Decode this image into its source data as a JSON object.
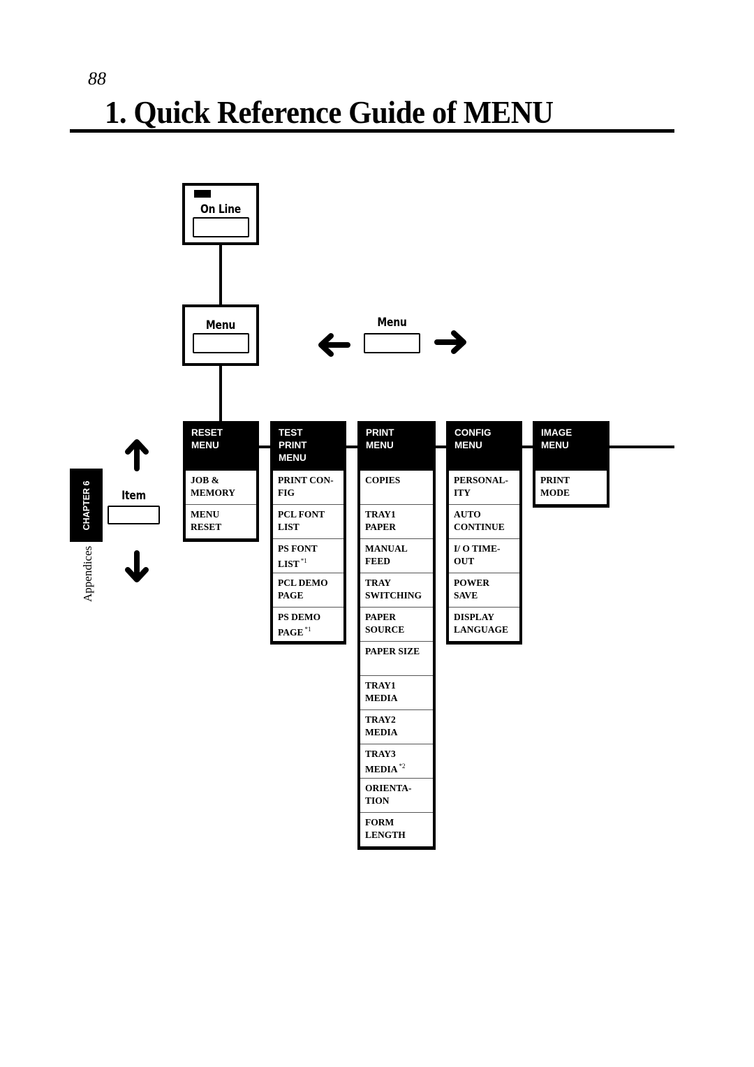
{
  "page": {
    "number": "88",
    "title": "1. Quick Reference Guide of MENU"
  },
  "panel": {
    "online_key": {
      "label": "On Line"
    },
    "menu_key": {
      "label": "Menu"
    },
    "menu_nav": {
      "label": "Menu",
      "left_icon": "arrow-left-icon",
      "right_icon": "arrow-right-icon"
    },
    "item_nav": {
      "label": "Item",
      "up_icon": "arrow-up-icon",
      "down_icon": "arrow-down-icon"
    }
  },
  "side_tab": {
    "chapter": "CHAPTER 6",
    "section": "Appendices"
  },
  "menus": [
    {
      "header": "RESET\nMENU",
      "items": [
        {
          "label": "JOB &\nMEMORY",
          "note": ""
        },
        {
          "label": "MENU\nRESET",
          "note": ""
        }
      ]
    },
    {
      "header": "TEST\nPRINT\nMENU",
      "items": [
        {
          "label": "PRINT CON-\nFIG",
          "note": ""
        },
        {
          "label": "PCL FONT\nLIST",
          "note": ""
        },
        {
          "label": "PS FONT\nLIST",
          "note": "*1"
        },
        {
          "label": "PCL DEMO\nPAGE",
          "note": ""
        },
        {
          "label": "PS DEMO\nPAGE",
          "note": "*1"
        }
      ]
    },
    {
      "header": "PRINT\nMENU",
      "items": [
        {
          "label": "COPIES",
          "note": ""
        },
        {
          "label": "TRAY1\nPAPER",
          "note": ""
        },
        {
          "label": "MANUAL\nFEED",
          "note": ""
        },
        {
          "label": "TRAY\nSWITCHING",
          "note": ""
        },
        {
          "label": "PAPER\nSOURCE",
          "note": ""
        },
        {
          "label": "PAPER SIZE",
          "note": ""
        },
        {
          "label": "TRAY1\nMEDIA",
          "note": ""
        },
        {
          "label": "TRAY2\nMEDIA",
          "note": ""
        },
        {
          "label": "TRAY3\nMEDIA",
          "note": "*2"
        },
        {
          "label": "ORIENTA-\nTION",
          "note": ""
        },
        {
          "label": "FORM\nLENGTH",
          "note": ""
        }
      ]
    },
    {
      "header": "CONFIG\nMENU",
      "items": [
        {
          "label": "PERSONAL-\nITY",
          "note": ""
        },
        {
          "label": "AUTO\nCONTINUE",
          "note": ""
        },
        {
          "label": "I/ O TIME-\nOUT",
          "note": ""
        },
        {
          "label": "POWER\nSAVE",
          "note": ""
        },
        {
          "label": "DISPLAY\nLANGUAGE",
          "note": ""
        }
      ]
    },
    {
      "header": "IMAGE\nMENU",
      "items": [
        {
          "label": "PRINT\nMODE",
          "note": ""
        }
      ]
    }
  ]
}
